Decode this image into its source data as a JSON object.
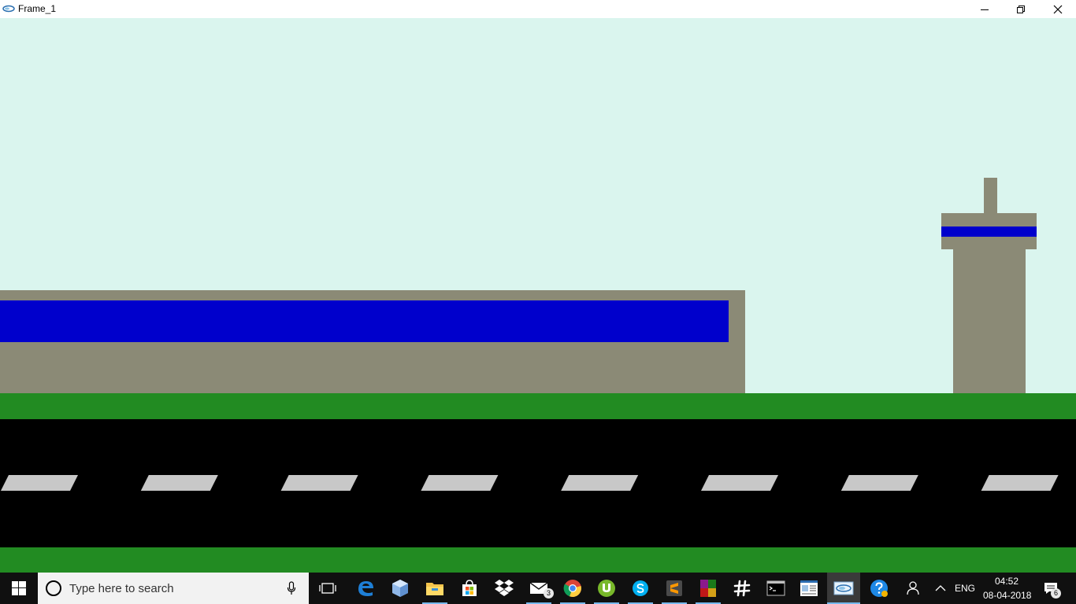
{
  "window": {
    "title": "Frame_1"
  },
  "scene": {
    "colors": {
      "sky": "#daf5ee",
      "building": "#8b8a76",
      "glass": "#0000cc",
      "grass": "#228b22",
      "road": "#000000",
      "stripe": "#c8c8c8"
    },
    "stripe_count": 8
  },
  "taskbar": {
    "search_placeholder": "Type here to search",
    "mail_badge": "3",
    "notification_badge": "6",
    "language": "ENG",
    "time": "04:52",
    "date": "08-04-2018",
    "icons": [
      "start-icon",
      "cortana-icon",
      "mic-icon",
      "task-view-icon",
      "edge-icon",
      "cube-app-icon",
      "file-explorer-icon",
      "store-icon",
      "dropbox-icon",
      "mail-icon",
      "chrome-icon",
      "utorrent-icon",
      "skype-icon",
      "sublime-text-icon",
      "winrar-icon",
      "slack-icon",
      "cmd-icon",
      "document-icon",
      "java-app-icon",
      "help-icon",
      "people-icon",
      "chevron-up-icon",
      "action-center-icon"
    ]
  }
}
